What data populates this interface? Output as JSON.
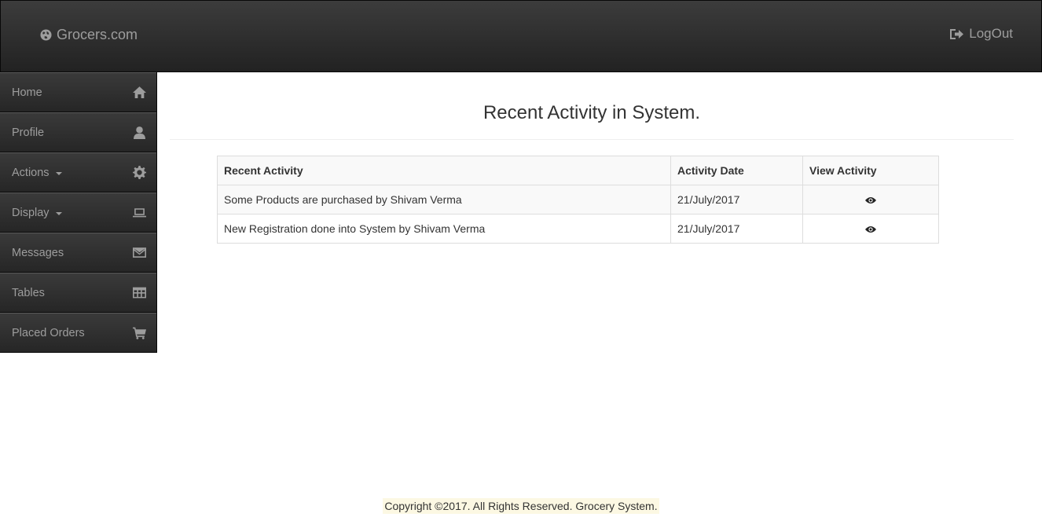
{
  "navbar": {
    "brand": "Grocers.com",
    "brand_icon": "globe-icon",
    "logout_label": "LogOut",
    "logout_icon": "log-out-icon"
  },
  "sidebar": {
    "items": [
      {
        "label": "Home",
        "icon": "home-icon",
        "dropdown": false
      },
      {
        "label": "Profile",
        "icon": "user-icon",
        "dropdown": false
      },
      {
        "label": "Actions",
        "icon": "gear-icon",
        "dropdown": true
      },
      {
        "label": "Display",
        "icon": "laptop-icon",
        "dropdown": true
      },
      {
        "label": "Messages",
        "icon": "envelope-icon",
        "dropdown": false
      },
      {
        "label": "Tables",
        "icon": "table-icon",
        "dropdown": false
      },
      {
        "label": "Placed Orders",
        "icon": "cart-icon",
        "dropdown": false
      }
    ]
  },
  "main": {
    "title": "Recent Activity in System.",
    "table": {
      "headers": [
        "Recent Activity",
        "Activity Date",
        "View Activity"
      ],
      "rows": [
        {
          "activity": "Some Products are purchased by Shivam Verma",
          "date": "21/July/2017",
          "view_icon": "eye-icon"
        },
        {
          "activity": "New Registration done into System by Shivam Verma",
          "date": "21/July/2017",
          "view_icon": "eye-icon"
        }
      ]
    }
  },
  "footer": {
    "text": "Copyright ©2017. All Rights Reserved. Grocery System."
  },
  "colors": {
    "navbar_bg": "#222222",
    "nav_text": "#9d9d9d",
    "footer_highlight": "#fcf8e3"
  }
}
